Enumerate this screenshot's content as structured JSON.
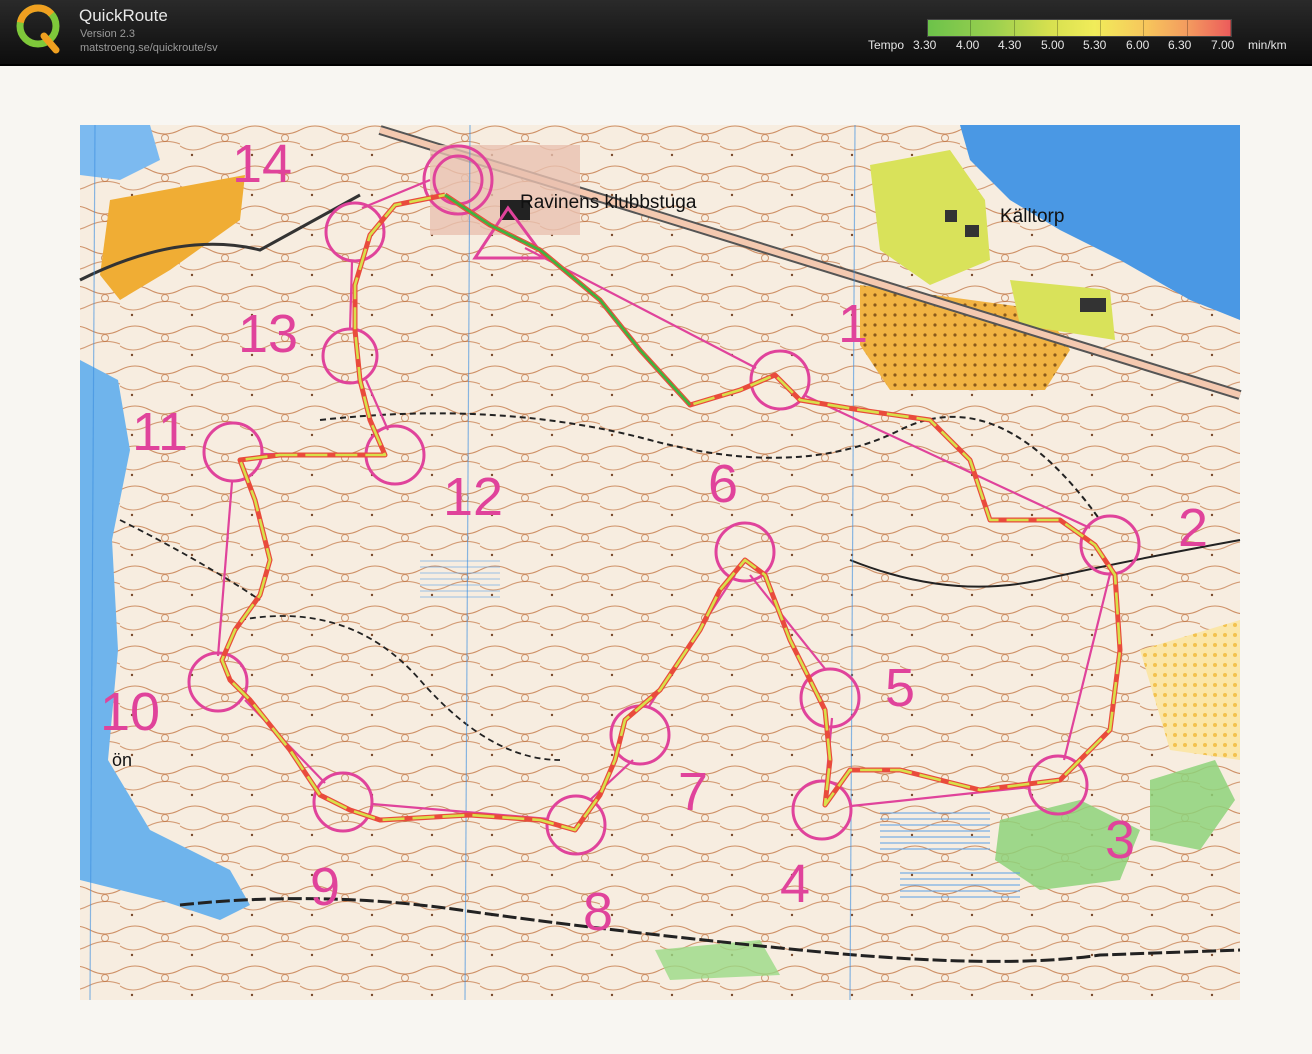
{
  "app": {
    "title": "QuickRoute",
    "version": "Version 2.3",
    "url": "matstroeng.se/quickroute/sv"
  },
  "legend": {
    "prefix": "Tempo",
    "ticks": [
      "3.30",
      "4.00",
      "4.30",
      "5.00",
      "5.30",
      "6.00",
      "6.30",
      "7.00"
    ],
    "unit": "min/km",
    "colors": [
      "#6cc24a",
      "#9cd04f",
      "#d6e04f",
      "#f1ec5a",
      "#f7c65c",
      "#f39a5f",
      "#ec5b5b"
    ]
  },
  "map": {
    "place_names": {
      "clubhouse": "Ravinens klubbstuga",
      "village": "Källtorp",
      "lake": "ön"
    },
    "controls": [
      {
        "number": "1"
      },
      {
        "number": "2"
      },
      {
        "number": "3"
      },
      {
        "number": "4"
      },
      {
        "number": "5"
      },
      {
        "number": "6"
      },
      {
        "number": "7"
      },
      {
        "number": "8"
      },
      {
        "number": "9"
      },
      {
        "number": "10"
      },
      {
        "number": "11"
      },
      {
        "number": "12"
      },
      {
        "number": "13"
      },
      {
        "number": "14"
      }
    ],
    "colors": {
      "course": "#e0439b",
      "contour": "#c0713d",
      "water": "#3d8fe0",
      "open": "#f3b23b",
      "green": "#7fcf6b",
      "route_fast": "#3fb23f",
      "route_slow": "#e94b3c"
    }
  }
}
